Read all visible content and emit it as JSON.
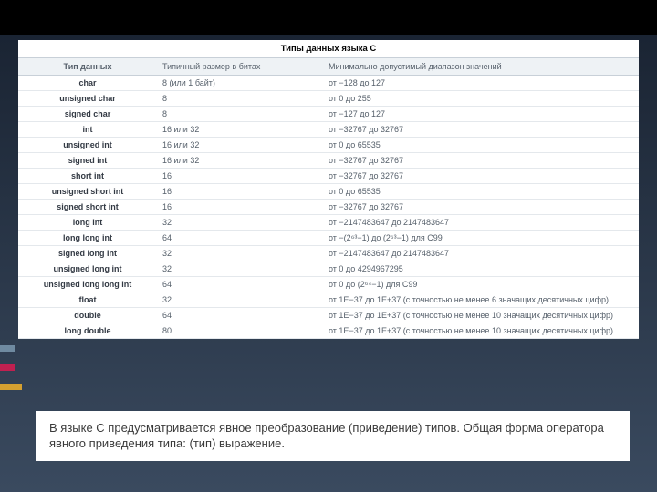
{
  "table": {
    "title": "Типы данных языка C",
    "headers": [
      "Тип данных",
      "Типичный размер в битах",
      "Минимально допустимый диапазон значений"
    ],
    "rows": [
      [
        "char",
        "8 (или 1 байт)",
        "от −128 до 127"
      ],
      [
        "unsigned char",
        "8",
        "от 0 до 255"
      ],
      [
        "signed char",
        "8",
        "от −127 до 127"
      ],
      [
        "int",
        "16 или 32",
        "от −32767 до 32767"
      ],
      [
        "unsigned int",
        "16 или 32",
        "от 0 до 65535"
      ],
      [
        "signed int",
        "16 или 32",
        "от −32767 до 32767"
      ],
      [
        "short int",
        "16",
        "от −32767 до 32767"
      ],
      [
        "unsigned short int",
        "16",
        "от 0 до 65535"
      ],
      [
        "signed short int",
        "16",
        "от −32767 до 32767"
      ],
      [
        "long int",
        "32",
        "от −2147483647 до 2147483647"
      ],
      [
        "long long int",
        "64",
        "от −(2⁶³−1) до (2⁶³−1) для C99"
      ],
      [
        "signed long int",
        "32",
        "от −2147483647 до 2147483647"
      ],
      [
        "unsigned long int",
        "32",
        "от 0 до 4294967295"
      ],
      [
        "unsigned long long int",
        "64",
        "от 0 до (2⁶⁴−1) для C99"
      ],
      [
        "float",
        "32",
        "от 1E−37 до 1E+37 (с точностью не менее 6 значащих десятичных цифр)"
      ],
      [
        "double",
        "64",
        "от 1E−37 до 1E+37 (с точностью не менее 10 значащих десятичных цифр)"
      ],
      [
        "long double",
        "80",
        "от 1E−37 до 1E+37 (с точностью не менее 10 значащих десятичных цифр)"
      ]
    ]
  },
  "caption": "В языке С предусматривается явное преобразование (приведение) типов. Общая форма оператора явного приведения типа: (тип) выражение."
}
